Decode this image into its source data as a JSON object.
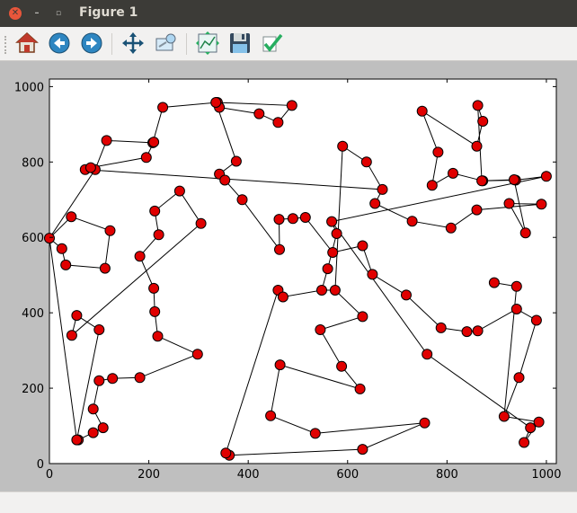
{
  "window": {
    "title": "Figure 1"
  },
  "toolbar": {
    "buttons": [
      {
        "name": "home-button",
        "icon": "home-icon"
      },
      {
        "name": "back-button",
        "icon": "back-arrow-icon"
      },
      {
        "name": "forward-button",
        "icon": "forward-arrow-icon"
      },
      {
        "name": "pan-button",
        "icon": "pan-move-icon"
      },
      {
        "name": "zoom-button",
        "icon": "zoom-rect-icon"
      },
      {
        "name": "configure-subplots-button",
        "icon": "subplots-icon"
      },
      {
        "name": "save-button",
        "icon": "save-disk-icon"
      },
      {
        "name": "edit-axis-button",
        "icon": "edit-check-icon"
      }
    ]
  },
  "chart_data": {
    "type": "line",
    "title": "",
    "xlabel": "",
    "ylabel": "",
    "xlim": [
      0,
      1020
    ],
    "ylim": [
      0,
      1020
    ],
    "xticks": [
      0,
      200,
      400,
      600,
      800,
      1000
    ],
    "yticks": [
      0,
      200,
      400,
      600,
      800,
      1000
    ],
    "grid": false,
    "series": [
      {
        "marker_color": "#e00000",
        "line_color": "#000000",
        "points": [
          [
            58,
            63
          ],
          [
            88,
            82
          ],
          [
            108,
            95
          ],
          [
            88,
            145
          ],
          [
            100,
            220
          ],
          [
            127,
            226
          ],
          [
            182,
            228
          ],
          [
            298,
            290
          ],
          [
            218,
            338
          ],
          [
            212,
            403
          ],
          [
            210,
            465
          ],
          [
            182,
            550
          ],
          [
            220,
            607
          ],
          [
            212,
            670
          ],
          [
            262,
            723
          ],
          [
            305,
            637
          ],
          [
            45,
            340
          ],
          [
            55,
            393
          ],
          [
            100,
            355
          ],
          [
            55,
            63
          ],
          [
            0,
            598
          ],
          [
            25,
            570
          ],
          [
            33,
            527
          ],
          [
            112,
            518
          ],
          [
            122,
            618
          ],
          [
            44,
            655
          ],
          [
            0,
            598
          ],
          [
            92,
            780
          ],
          [
            115,
            857
          ],
          [
            208,
            851
          ],
          [
            228,
            945
          ],
          [
            338,
            958
          ],
          [
            342,
            945
          ],
          [
            422,
            928
          ],
          [
            460,
            905
          ],
          [
            488,
            950
          ],
          [
            335,
            958
          ],
          [
            376,
            802
          ],
          [
            342,
            768
          ],
          [
            353,
            752
          ],
          [
            388,
            700
          ],
          [
            463,
            568
          ],
          [
            462,
            648
          ],
          [
            490,
            650
          ],
          [
            515,
            653
          ],
          [
            570,
            560
          ],
          [
            630,
            578
          ],
          [
            650,
            502
          ],
          [
            718,
            447
          ],
          [
            788,
            360
          ],
          [
            840,
            350
          ],
          [
            862,
            352
          ],
          [
            940,
            410
          ],
          [
            980,
            380
          ],
          [
            945,
            228
          ],
          [
            915,
            125
          ],
          [
            985,
            110
          ],
          [
            955,
            56
          ],
          [
            968,
            95
          ],
          [
            760,
            290
          ],
          [
            568,
            642
          ],
          [
            578,
            610
          ],
          [
            560,
            517
          ],
          [
            548,
            460
          ],
          [
            575,
            460
          ],
          [
            630,
            390
          ],
          [
            545,
            355
          ],
          [
            588,
            258
          ],
          [
            625,
            198
          ],
          [
            464,
            262
          ],
          [
            445,
            127
          ],
          [
            535,
            80
          ],
          [
            755,
            108
          ],
          [
            630,
            38
          ],
          [
            362,
            22
          ],
          [
            355,
            28
          ],
          [
            460,
            460
          ],
          [
            470,
            442
          ],
          [
            548,
            460
          ],
          [
            575,
            460
          ],
          [
            590,
            842
          ],
          [
            638,
            800
          ],
          [
            670,
            727
          ],
          [
            72,
            780
          ],
          [
            83,
            785
          ],
          [
            195,
            812
          ],
          [
            210,
            853
          ]
        ]
      }
    ],
    "route_b": [
      [
        568,
        642
      ],
      [
        1000,
        762
      ],
      [
        938,
        752
      ],
      [
        872,
        750
      ],
      [
        812,
        770
      ],
      [
        770,
        738
      ],
      [
        782,
        826
      ],
      [
        750,
        935
      ],
      [
        860,
        842
      ],
      [
        872,
        908
      ],
      [
        862,
        950
      ],
      [
        870,
        750
      ],
      [
        935,
        753
      ],
      [
        958,
        612
      ],
      [
        925,
        690
      ],
      [
        990,
        688
      ],
      [
        860,
        673
      ],
      [
        808,
        625
      ],
      [
        730,
        643
      ],
      [
        655,
        690
      ],
      [
        670,
        727
      ]
    ],
    "route_c": [
      [
        895,
        480
      ],
      [
        940,
        470
      ],
      [
        915,
        125
      ]
    ]
  }
}
